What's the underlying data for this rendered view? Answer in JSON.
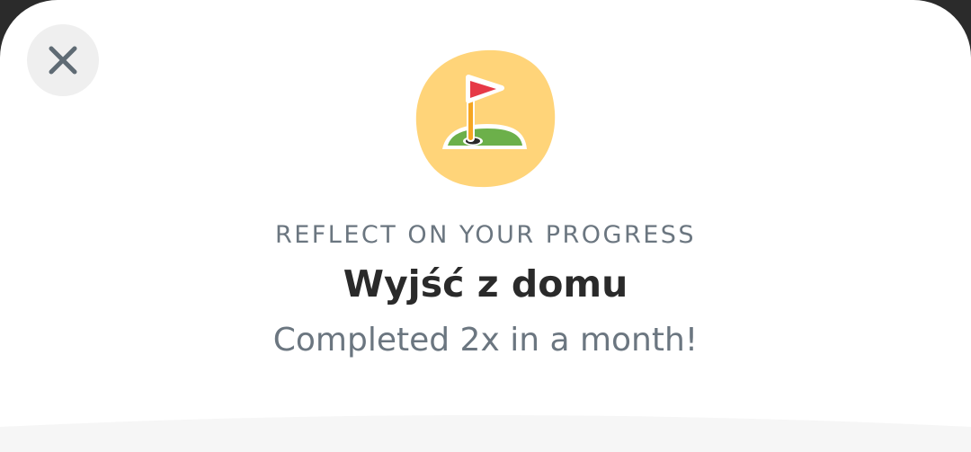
{
  "header": {
    "close_icon": "close-icon"
  },
  "badge": {
    "icon": "golf-flag-icon",
    "background_color": "#FFD479",
    "flag_color": "#E63946",
    "green_color": "#6CB04A"
  },
  "content": {
    "eyebrow": "REFLECT ON YOUR PROGRESS",
    "habit_name": "Wyjść z domu",
    "summary": "Completed 2x in a month!"
  },
  "colors": {
    "text_muted": "#6B7680",
    "text_dark": "#2A2A2A",
    "close_bg": "#EFEFEF",
    "sheet_bg": "#FFFFFF",
    "bottom_panel": "#F6F6F6"
  }
}
